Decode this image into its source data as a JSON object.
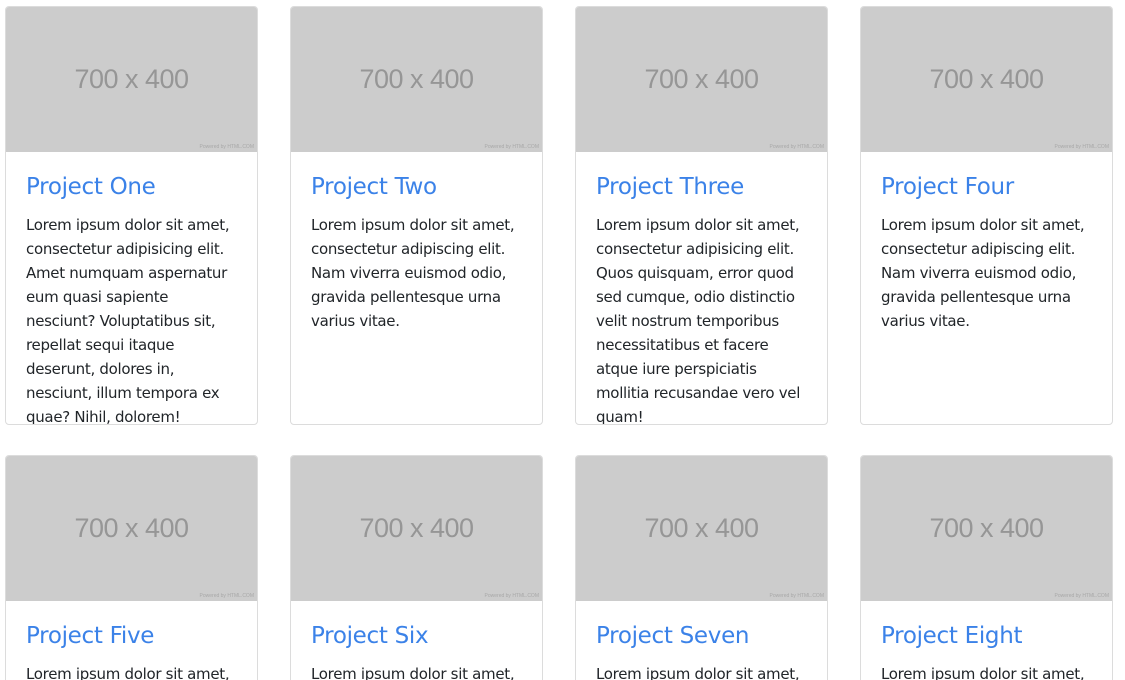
{
  "placeholder": {
    "label": "700 x 400",
    "credit": "Powered by HTML.COM"
  },
  "projects": [
    {
      "title": "Project One",
      "text": "Lorem ipsum dolor sit amet, consectetur adipisicing elit. Amet numquam aspernatur eum quasi sapiente nesciunt? Voluptatibus sit, repellat sequi itaque deserunt, dolores in, nesciunt, illum tempora ex quae? Nihil, dolorem!"
    },
    {
      "title": "Project Two",
      "text": "Lorem ipsum dolor sit amet, consectetur adipiscing elit. Nam viverra euismod odio, gravida pellentesque urna varius vitae."
    },
    {
      "title": "Project Three",
      "text": "Lorem ipsum dolor sit amet, consectetur adipisicing elit. Quos quisquam, error quod sed cumque, odio distinctio velit nostrum temporibus necessitatibus et facere atque iure perspiciatis mollitia recusandae vero vel quam!"
    },
    {
      "title": "Project Four",
      "text": "Lorem ipsum dolor sit amet, consectetur adipiscing elit. Nam viverra euismod odio, gravida pellentesque urna varius vitae."
    },
    {
      "title": "Project Five",
      "text": "Lorem ipsum dolor sit amet,"
    },
    {
      "title": "Project Six",
      "text": "Lorem ipsum dolor sit amet,"
    },
    {
      "title": "Project Seven",
      "text": "Lorem ipsum dolor sit amet,"
    },
    {
      "title": "Project Eight",
      "text": "Lorem ipsum dolor sit amet,"
    }
  ],
  "colors": {
    "title": "#3b82e8",
    "body_text": "#212529",
    "placeholder_bg": "#cccccc",
    "placeholder_text": "#969696"
  }
}
